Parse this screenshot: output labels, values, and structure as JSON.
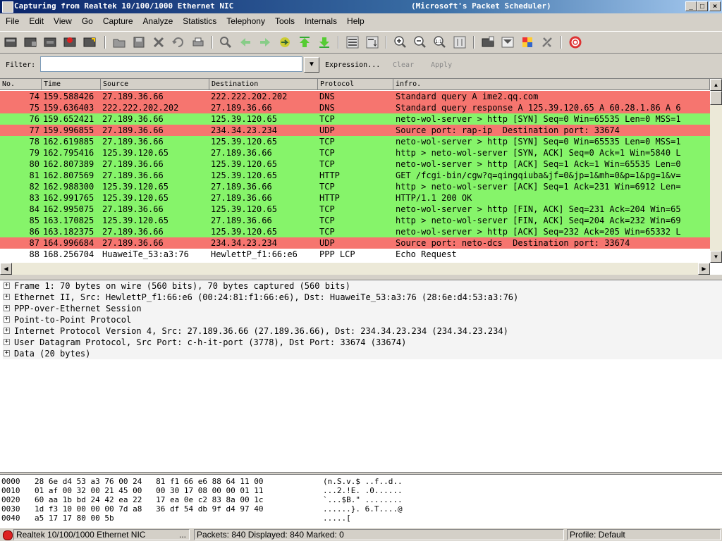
{
  "window": {
    "title": "Capturing from Realtek 10/100/1000 Ethernet NIC",
    "title_suffix": "(Microsoft's Packet Scheduler)",
    "controls": [
      "_",
      "□",
      "×"
    ]
  },
  "menu": [
    "File",
    "Edit",
    "View",
    "Go",
    "Capture",
    "Analyze",
    "Statistics",
    "Telephony",
    "Tools",
    "Internals",
    "Help"
  ],
  "toolbar": {
    "buttons": [
      "interface-list",
      "capture-options",
      "start-capture",
      "stop-capture",
      "restart-capture",
      "open-file",
      "save-file",
      "close-file",
      "reload-file",
      "print",
      "find-packet",
      "go-back",
      "go-forward",
      "go-to-packet",
      "go-first",
      "go-last",
      "colorize",
      "autoscroll",
      "zoom-in",
      "zoom-out",
      "zoom-normal",
      "resize-columns",
      "capture-filters",
      "display-filters",
      "coloring-rules",
      "preferences",
      "help"
    ]
  },
  "filter": {
    "label": "Filter:",
    "value": "",
    "expression": "Expression...",
    "clear": "Clear",
    "apply": "Apply"
  },
  "packet_list": {
    "columns": [
      "No.",
      "Time",
      "Source",
      "Destination",
      "Protocol",
      "infro."
    ],
    "rows": [
      {
        "no": "74",
        "time": "159.588426",
        "src": "27.189.36.66",
        "dst": "222.222.202.202",
        "proto": "DNS",
        "info": "Standard query A ime2.qq.com",
        "color": "#f6756f"
      },
      {
        "no": "75",
        "time": "159.636403",
        "src": "222.222.202.202",
        "dst": "27.189.36.66",
        "proto": "DNS",
        "info": "Standard query response A 125.39.120.65 A 60.28.1.86 A 6",
        "color": "#f6756f"
      },
      {
        "no": "76",
        "time": "159.652421",
        "src": "27.189.36.66",
        "dst": "125.39.120.65",
        "proto": "TCP",
        "info": "neto-wol-server > http [SYN] Seq=0 Win=65535 Len=0 MSS=1",
        "color": "#86f46a"
      },
      {
        "no": "77",
        "time": "159.996855",
        "src": "27.189.36.66",
        "dst": "234.34.23.234",
        "proto": "UDP",
        "info": "Source port: rap-ip  Destination port: 33674",
        "color": "#f6756f"
      },
      {
        "no": "78",
        "time": "162.619885",
        "src": "27.189.36.66",
        "dst": "125.39.120.65",
        "proto": "TCP",
        "info": "neto-wol-server > http [SYN] Seq=0 Win=65535 Len=0 MSS=1",
        "color": "#86f46a"
      },
      {
        "no": "79",
        "time": "162.795416",
        "src": "125.39.120.65",
        "dst": "27.189.36.66",
        "proto": "TCP",
        "info": "http > neto-wol-server [SYN, ACK] Seq=0 Ack=1 Win=5840 L",
        "color": "#86f46a"
      },
      {
        "no": "80",
        "time": "162.807389",
        "src": "27.189.36.66",
        "dst": "125.39.120.65",
        "proto": "TCP",
        "info": "neto-wol-server > http [ACK] Seq=1 Ack=1 Win=65535 Len=0",
        "color": "#86f46a"
      },
      {
        "no": "81",
        "time": "162.807569",
        "src": "27.189.36.66",
        "dst": "125.39.120.65",
        "proto": "HTTP",
        "info": "GET /fcgi-bin/cgw?q=qingqiuba&jf=0&jp=1&mh=0&p=1&pg=1&v=",
        "color": "#86f46a"
      },
      {
        "no": "82",
        "time": "162.988300",
        "src": "125.39.120.65",
        "dst": "27.189.36.66",
        "proto": "TCP",
        "info": "http > neto-wol-server [ACK] Seq=1 Ack=231 Win=6912 Len=",
        "color": "#86f46a"
      },
      {
        "no": "83",
        "time": "162.991765",
        "src": "125.39.120.65",
        "dst": "27.189.36.66",
        "proto": "HTTP",
        "info": "HTTP/1.1 200 OK",
        "color": "#86f46a"
      },
      {
        "no": "84",
        "time": "162.995075",
        "src": "27.189.36.66",
        "dst": "125.39.120.65",
        "proto": "TCP",
        "info": "neto-wol-server > http [FIN, ACK] Seq=231 Ack=204 Win=65",
        "color": "#86f46a"
      },
      {
        "no": "85",
        "time": "163.170825",
        "src": "125.39.120.65",
        "dst": "27.189.36.66",
        "proto": "TCP",
        "info": "http > neto-wol-server [FIN, ACK] Seq=204 Ack=232 Win=69",
        "color": "#86f46a"
      },
      {
        "no": "86",
        "time": "163.182375",
        "src": "27.189.36.66",
        "dst": "125.39.120.65",
        "proto": "TCP",
        "info": "neto-wol-server > http [ACK] Seq=232 Ack=205 Win=65332 L",
        "color": "#86f46a"
      },
      {
        "no": "87",
        "time": "164.996684",
        "src": "27.189.36.66",
        "dst": "234.34.23.234",
        "proto": "UDP",
        "info": "Source port: neto-dcs  Destination port: 33674",
        "color": "#f6756f"
      },
      {
        "no": "88",
        "time": "168.256704",
        "src": "HuaweiTe_53:a3:76",
        "dst": "HewlettP_f1:66:e6",
        "proto": "PPP LCP",
        "info": "Echo Request",
        "color": "#ffffff"
      }
    ]
  },
  "details": [
    "Frame 1: 70 bytes on wire (560 bits), 70 bytes captured (560 bits)",
    "Ethernet II, Src: HewlettP_f1:66:e6 (00:24:81:f1:66:e6), Dst: HuaweiTe_53:a3:76 (28:6e:d4:53:a3:76)",
    "PPP-over-Ethernet Session",
    "Point-to-Point Protocol",
    "Internet Protocol Version 4, Src: 27.189.36.66 (27.189.36.66), Dst: 234.34.23.234 (234.34.23.234)",
    "User Datagram Protocol, Src Port: c-h-it-port (3778), Dst Port: 33674 (33674)",
    "Data (20 bytes)"
  ],
  "hex": [
    {
      "off": "0000",
      "bytes": "28 6e d4 53 a3 76 00 24   81 f1 66 e6 88 64 11 00",
      "ascii": "(n.S.v.$ ..f..d.."
    },
    {
      "off": "0010",
      "bytes": "01 af 00 32 00 21 45 00   00 30 17 08 00 00 01 11",
      "ascii": "...2.!E. .0......"
    },
    {
      "off": "0020",
      "bytes": "60 aa 1b bd 24 42 ea 22   17 ea 0e c2 83 8a 00 1c",
      "ascii": "`...$B.\" ........"
    },
    {
      "off": "0030",
      "bytes": "1d f3 10 00 00 00 7d a8   36 df 54 db 9f d4 97 40",
      "ascii": "......}. 6.T....@"
    },
    {
      "off": "0040",
      "bytes": "a5 17 17 80 00 5b",
      "ascii": ".....["
    }
  ],
  "status": {
    "interface": "Realtek 10/100/1000 Ethernet NIC",
    "ellipsis": "...",
    "packets": "Packets: 840 Displayed: 840 Marked: 0",
    "profile": "Profile: Default"
  }
}
